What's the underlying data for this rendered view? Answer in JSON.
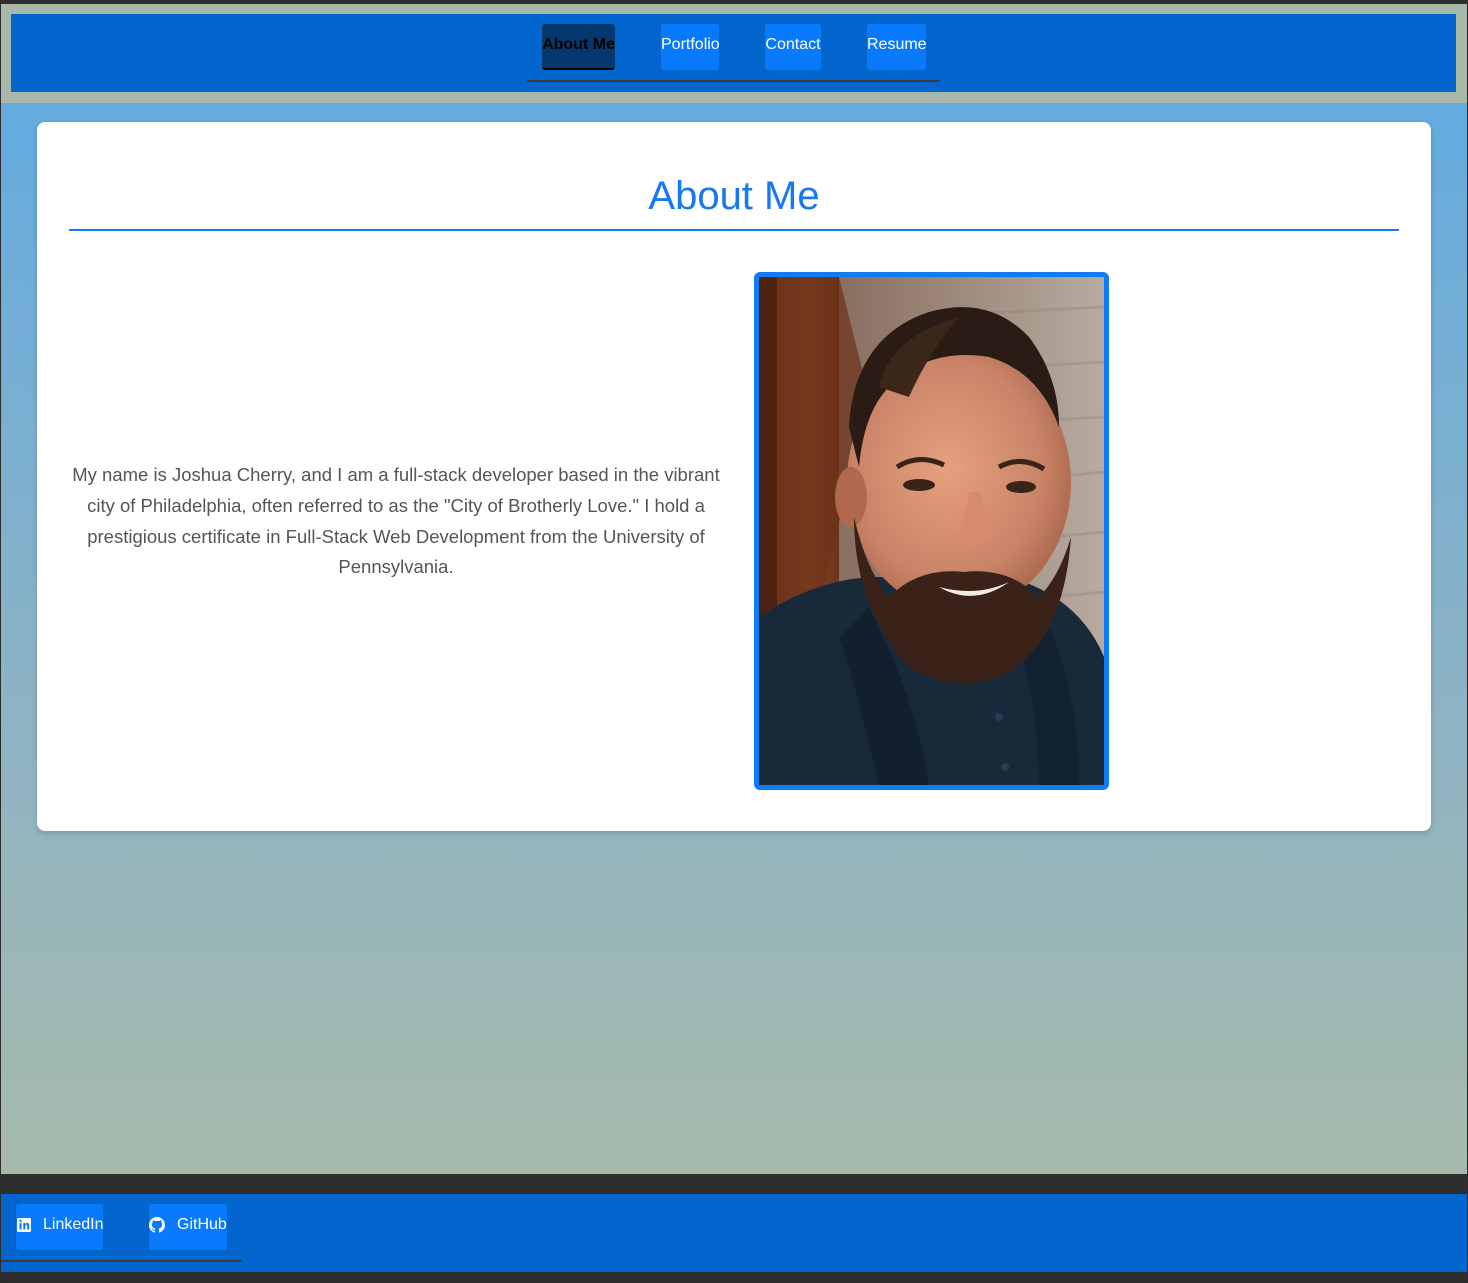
{
  "nav": {
    "items": [
      {
        "label": "About Me",
        "active": true
      },
      {
        "label": "Portfolio",
        "active": false
      },
      {
        "label": "Contact",
        "active": false
      },
      {
        "label": "Resume",
        "active": false
      }
    ]
  },
  "about": {
    "title": "About Me",
    "bio": "My name is Joshua Cherry, and I am a full-stack developer based in the vibrant city of Philadelphia, often referred to as the \"City of Brotherly Love.\" I hold a prestigious certificate in Full-Stack Web Development from the University of Pennsylvania.",
    "photo_alt": "Joshua Cherry"
  },
  "footer": {
    "links": [
      {
        "label": "LinkedIn",
        "icon": "linkedin-icon"
      },
      {
        "label": "GitHub",
        "icon": "github-icon"
      }
    ]
  },
  "colors": {
    "primary_blue": "#0266ce",
    "button_blue": "#0a7afc",
    "accent_blue": "#1778f2",
    "active_nav": "#05386e",
    "header_frame": "#a8b9a9",
    "dark_strip": "#2e2e2e"
  }
}
